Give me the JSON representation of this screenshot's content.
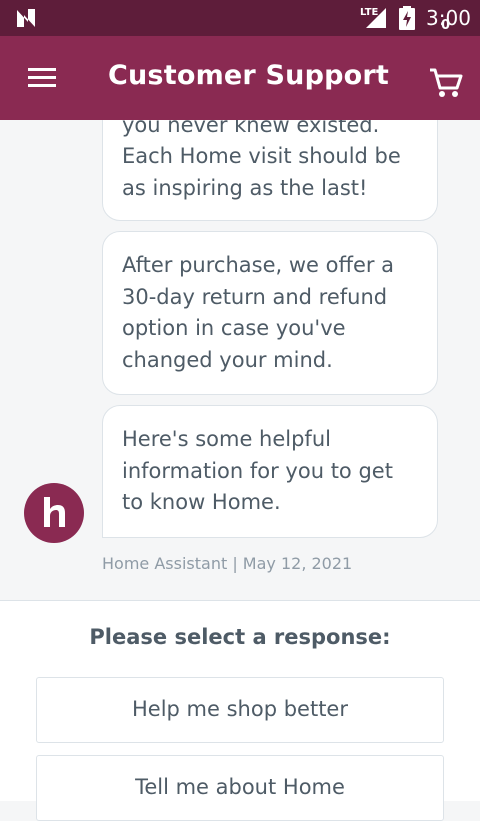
{
  "status_bar": {
    "network": "LTE",
    "time": "3:00"
  },
  "app_bar": {
    "title": "Customer Support",
    "cart_count": "0"
  },
  "messages": [
    {
      "text": "you never knew existed. Each Home visit should be as inspiring as the last!"
    },
    {
      "text": "After purchase, we offer a 30-day return and refund option in case you've changed your mind."
    },
    {
      "text": "Here's some helpful information for you to get to know Home."
    }
  ],
  "meta": {
    "sender_date": "Home Assistant | May 12, 2021"
  },
  "responses": {
    "prompt": "Please select a response:",
    "options": [
      "Help me shop better",
      "Tell me about Home"
    ]
  },
  "colors": {
    "brand": "#8a2a52",
    "status_bar": "#5e1d3a",
    "text": "#4e5b66"
  },
  "icons": [
    "n-logo-icon",
    "signal-icon",
    "battery-charging-icon",
    "menu-icon",
    "cart-icon",
    "home-logo-icon"
  ]
}
